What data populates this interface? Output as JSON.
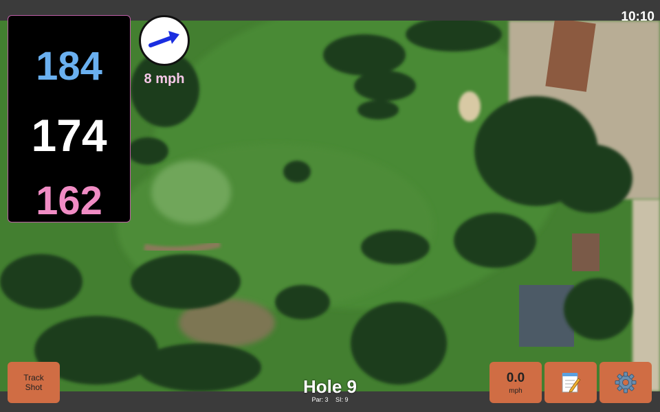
{
  "status": {
    "time": "10:10"
  },
  "distances": {
    "back": "184",
    "middle": "174",
    "front": "162"
  },
  "wind": {
    "speed": "8 mph",
    "direction_icon": "wind-arrow-icon"
  },
  "hole": {
    "title": "Hole 9",
    "par": "Par: 3",
    "stroke_index": "SI: 9"
  },
  "buttons": {
    "track_shot_line1": "Track",
    "track_shot_line2": "Shot",
    "speed_value": "0.0",
    "speed_unit": "mph",
    "notes_icon": "notepad-icon",
    "settings_icon": "gear-icon"
  },
  "colors": {
    "back": "#6ab0f0",
    "middle": "#ffffff",
    "front": "#f08cc4",
    "button": "#d06d44",
    "wind_arrow": "#1a2ee0"
  }
}
